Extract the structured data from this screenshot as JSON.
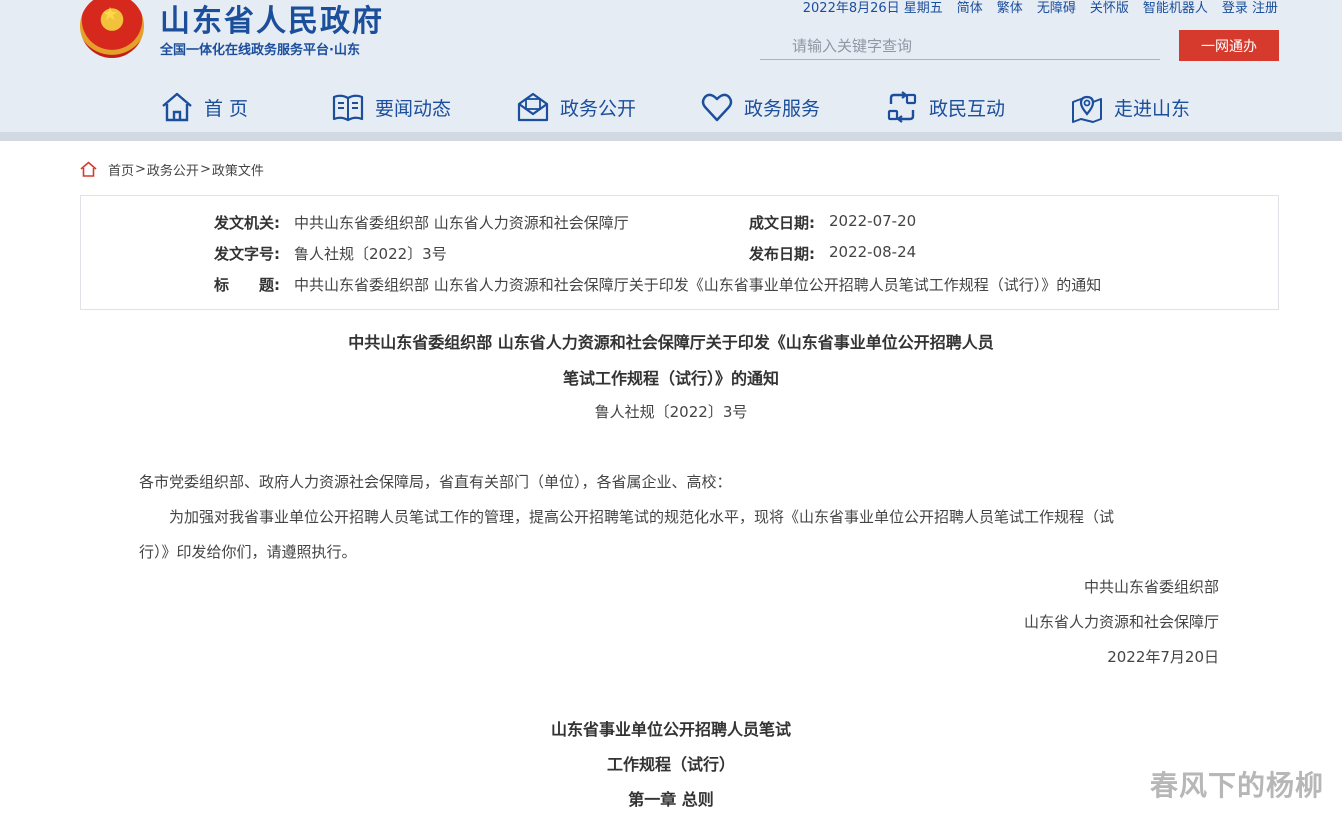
{
  "header": {
    "site_title": "山东省人民政府",
    "site_subtitle": "全国一体化在线政务服务平台·山东",
    "date": "2022年8月26日 星期五",
    "links": [
      "简体",
      "繁体",
      "无障碍",
      "关怀版",
      "智能机器人",
      "登录 注册"
    ],
    "search_placeholder": "请输入关键字查询",
    "ywtb_label": "一网通办"
  },
  "nav": {
    "items": [
      "首 页",
      "要闻动态",
      "政务公开",
      "政务服务",
      "政民互动",
      "走进山东"
    ]
  },
  "breadcrumb": {
    "items": [
      "首页",
      "政务公开",
      "政策文件"
    ],
    "separator": ">"
  },
  "info": {
    "issuer_label": "发文机关:",
    "issuer": "中共山东省委组织部 山东省人力资源和社会保障厅",
    "created_label": "成文日期:",
    "created": "2022-07-20",
    "doc_no_label": "发文字号:",
    "doc_no": "鲁人社规〔2022〕3号",
    "published_label": "发布日期:",
    "published": "2022-08-24",
    "title_label": "标　　题:",
    "title": "中共山东省委组织部 山东省人力资源和社会保障厅关于印发《山东省事业单位公开招聘人员笔试工作规程（试行）》的通知"
  },
  "doc": {
    "title_line1": "中共山东省委组织部 山东省人力资源和社会保障厅关于印发《山东省事业单位公开招聘人员",
    "title_line2": "笔试工作规程（试行）》的通知",
    "doc_no": "鲁人社规〔2022〕3号",
    "salutation": "各市党委组织部、政府人力资源社会保障局，省直有关部门（单位），各省属企业、高校：",
    "body_line1": "为加强对我省事业单位公开招聘人员笔试工作的管理，提高公开招聘笔试的规范化水平，现将《山东省事业单位公开招聘人员笔试工作规程（试",
    "body_line2": "行）》印发给你们，请遵照执行。",
    "sign1": "中共山东省委组织部",
    "sign2": "山东省人力资源和社会保障厅",
    "sign_date": "2022年7月20日",
    "sub_title1": "山东省事业单位公开招聘人员笔试",
    "sub_title2": "工作规程（试行）",
    "chapter1": "第一章 总则"
  },
  "watermark": "春风下的杨柳",
  "colors": {
    "brand_blue": "#1b4e9b",
    "header_bg": "#e6ecf4",
    "button_red": "#d63a2d"
  }
}
